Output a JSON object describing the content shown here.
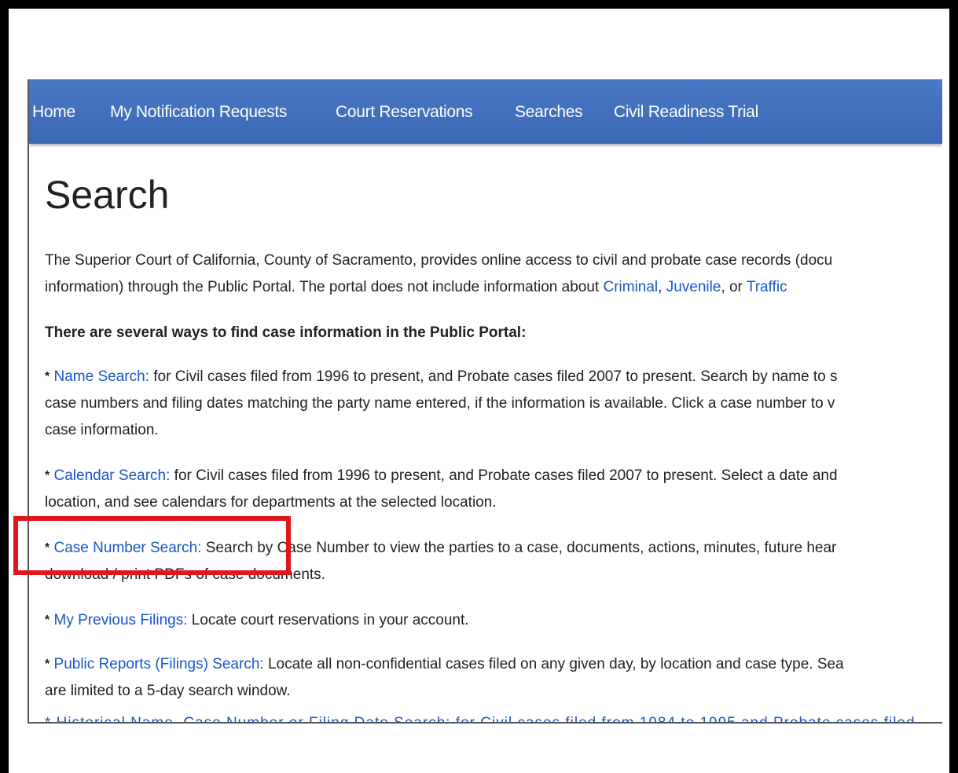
{
  "nav": {
    "items": [
      "Home",
      "My Notification Requests",
      "Court Reservations",
      "Searches",
      "Civil Readiness Trial"
    ]
  },
  "page": {
    "title": "Search",
    "intro": {
      "line1": "The Superior Court of California, County of Sacramento, provides online access to civil and probate case records (docu",
      "line2_prefix": "information) through the Public Portal. The portal does not include information about ",
      "criminal": "Criminal",
      "comma1": ", ",
      "juvenile": "Juvenile",
      "comma_or": ", or ",
      "traffic": "Traffic"
    },
    "ways_heading": "There are several ways to find case information in the Public Portal:",
    "bullet": "*",
    "items": [
      {
        "link": "Name Search:",
        "lines": [
          " for Civil cases filed from 1996 to present, and Probate cases filed 2007 to present. Search by name to s",
          "case numbers and filing dates matching the party name entered, if the information is available. Click a case number to v",
          "case information."
        ]
      },
      {
        "link": "Calendar Search:",
        "lines": [
          " for Civil cases filed from 1996 to present, and Probate cases filed 2007 to present. Select a date and",
          "location, and see calendars for departments at the selected location."
        ]
      },
      {
        "link": "Case Number Search:",
        "lines": [
          " Search by Case Number to view the parties to a case, documents, actions, minutes, future hear",
          "download / print PDFs of case documents."
        ]
      },
      {
        "link": "My Previous Filings:",
        "lines": [
          " Locate court reservations in your account."
        ]
      },
      {
        "link": "Public Reports (Filings) Search:",
        "lines": [
          " Locate all non-confidential cases filed on any given day, by location and case type. Sea",
          "are limited to a 5-day search window."
        ]
      }
    ],
    "cut_off_text": "* Historical Name, Case Number or Filing Date Search: for Civil cases filed from 1984 to 1995 and Probate cases filed"
  },
  "colors": {
    "nav_bg": "#3f6dbb",
    "link": "#1a56c7",
    "highlight": "#e0161b"
  }
}
